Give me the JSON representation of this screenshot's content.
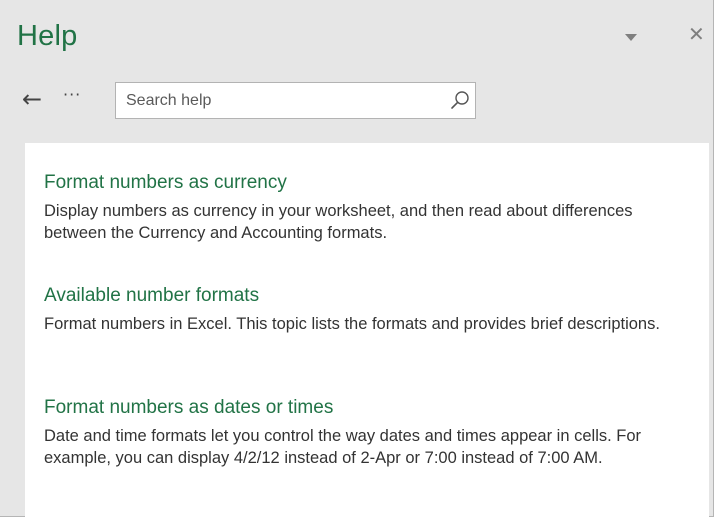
{
  "pane": {
    "title": "Help",
    "options_icon": "chevron-down-icon",
    "close_icon": "close-icon",
    "close_glyph": "✕"
  },
  "nav": {
    "back_icon": "arrow-left-icon",
    "back_glyph": "←",
    "more_icon": "more-options-icon",
    "more_glyph": "···"
  },
  "search": {
    "placeholder": "Search help",
    "value": "",
    "icon": "search-icon"
  },
  "results": [
    {
      "title": "Format numbers as currency",
      "description": "Display numbers as currency in your worksheet, and then read about differences between the Currency and Accounting formats."
    },
    {
      "title": "Available number formats",
      "description": "Format numbers in Excel. This topic lists the formats and provides brief descriptions."
    },
    {
      "title": "Format numbers as dates or times",
      "description": "Date and time formats let you control the way dates and times appear in cells. For example, you can display 4/2/12 instead of 2-Apr or 7:00 instead of 7:00 AM."
    }
  ],
  "colors": {
    "accent": "#217346",
    "pane_background": "#e6e6e6",
    "text": "#333333"
  }
}
